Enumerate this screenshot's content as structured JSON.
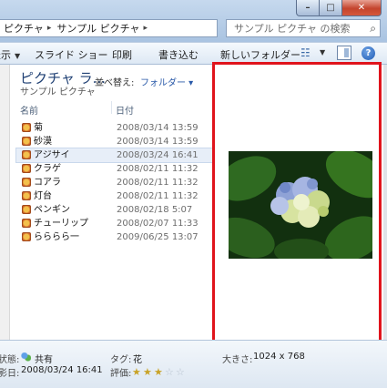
{
  "window": {
    "address": [
      "ピクチャ",
      "サンプル ピクチャ"
    ],
    "search_placeholder": "サンプル ピクチャ の検索",
    "buttons": {
      "minimize": "–",
      "maximize": "□",
      "close": "✕"
    }
  },
  "toolbar": {
    "items": [
      {
        "label": "表示",
        "dropdown": true
      },
      {
        "label": "スライド ショー",
        "dropdown": false
      },
      {
        "label": "印刷",
        "dropdown": false
      },
      {
        "label": "書き込む",
        "dropdown": false
      },
      {
        "label": "新しいフォルダー",
        "dropdown": false
      }
    ],
    "help": "?"
  },
  "library": {
    "title": "ピクチャ ラ...",
    "subtitle": "サンプル ピクチャ",
    "arrange_label": "並べ替え:",
    "arrange_value": "フォルダー ▾"
  },
  "columns": {
    "name": "名前",
    "date": "日付"
  },
  "files": [
    {
      "name": "菊",
      "date": "2008/03/14 13:59"
    },
    {
      "name": "砂漠",
      "date": "2008/03/14 13:59"
    },
    {
      "name": "アジサイ",
      "date": "2008/03/24 16:41"
    },
    {
      "name": "クラゲ",
      "date": "2008/02/11 11:32"
    },
    {
      "name": "コアラ",
      "date": "2008/02/11 11:32"
    },
    {
      "name": "灯台",
      "date": "2008/02/11 11:32"
    },
    {
      "name": "ペンギン",
      "date": "2008/02/18 5:07"
    },
    {
      "name": "チューリップ",
      "date": "2008/02/07 11:33"
    },
    {
      "name": "らららら一",
      "date": "2009/06/25 13:07"
    }
  ],
  "selected_index": 2,
  "details": {
    "state_label": "状態:",
    "state_value": "共有",
    "shot_label": "撮影日:",
    "shot_value": "2008/03/24 16:41",
    "tag_label": "タグ:",
    "tag_value": "花",
    "rating_label": "評価:",
    "rating_value": 3,
    "rating_max": 5,
    "size_label": "大きさ:",
    "size_value": "1024 x 768"
  },
  "colors": {
    "highlight_frame": "#e0141c",
    "accent": "#1e3f73"
  }
}
